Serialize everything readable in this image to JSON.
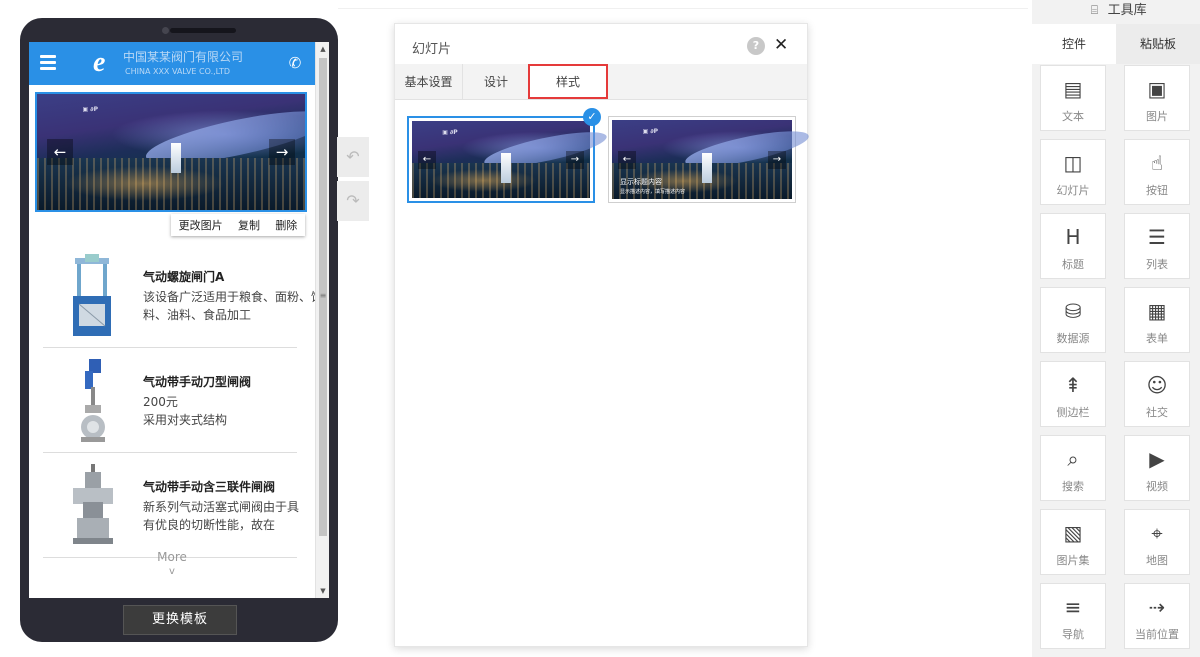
{
  "phone": {
    "company_cn": "中国某某阀门有限公司",
    "company_en": "CHINA XXX VALVE CO.,LTD",
    "banner_tools": [
      "更改图片",
      "复制",
      "删除"
    ],
    "products": [
      {
        "title": "气动螺旋闸门A",
        "desc": "该设备广泛适用于粮食、面粉、饲料、油料、食品加工"
      },
      {
        "title": "气动带手动刀型闸阀",
        "desc": "200元\n采用对夹式结构"
      },
      {
        "title": "气动带手动含三联件闸阀",
        "desc": "新系列气动活塞式闸阀由于具有优良的切断性能，故在"
      }
    ],
    "more": "More",
    "more_chevron": "v",
    "change_template": "更换模板"
  },
  "panel": {
    "title": "幻灯片",
    "help": "?",
    "close": "✕",
    "tabs": [
      "基本设置",
      "设计",
      "样式"
    ],
    "active_tab": "样式",
    "style2_caption_title": "显示标题内容",
    "style2_caption_sub": "显示描述内容，填写描述内容"
  },
  "toolbox": {
    "title": "工具库",
    "tabs": [
      "控件",
      "粘贴板"
    ],
    "tools": [
      {
        "label": "文本",
        "icon": "text-icon"
      },
      {
        "label": "图片",
        "icon": "image-icon"
      },
      {
        "label": "幻灯片",
        "icon": "slideshow-icon"
      },
      {
        "label": "按钮",
        "icon": "button-icon"
      },
      {
        "label": "标题",
        "icon": "heading-icon"
      },
      {
        "label": "列表",
        "icon": "list-icon"
      },
      {
        "label": "数据源",
        "icon": "database-icon"
      },
      {
        "label": "表单",
        "icon": "form-icon"
      },
      {
        "label": "侧边栏",
        "icon": "sidebar-icon"
      },
      {
        "label": "社交",
        "icon": "social-icon"
      },
      {
        "label": "搜索",
        "icon": "search-icon"
      },
      {
        "label": "视频",
        "icon": "video-icon"
      },
      {
        "label": "图片集",
        "icon": "gallery-icon"
      },
      {
        "label": "地图",
        "icon": "map-icon"
      },
      {
        "label": "导航",
        "icon": "nav-icon"
      },
      {
        "label": "当前位置",
        "icon": "breadcrumb-icon"
      }
    ]
  },
  "colors": {
    "accent": "#2a90e6",
    "highlight": "#e53a3a",
    "phone_body": "#2b2b35"
  }
}
